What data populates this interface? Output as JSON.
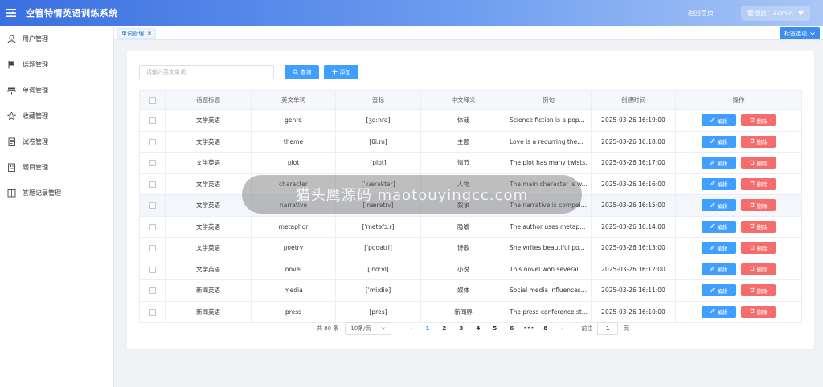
{
  "header": {
    "app_title": "空管特情英语训练系统",
    "back_home": "返回首页",
    "admin_label": "管理员：admin"
  },
  "sidebar": {
    "items": [
      {
        "label": "用户管理",
        "icon": "user-icon"
      },
      {
        "label": "话题管理",
        "icon": "flag-icon"
      },
      {
        "label": "单词管理",
        "icon": "sign-icon"
      },
      {
        "label": "收藏管理",
        "icon": "star-icon"
      },
      {
        "label": "试卷管理",
        "icon": "document-icon"
      },
      {
        "label": "题目管理",
        "icon": "form-icon"
      },
      {
        "label": "答题记录管理",
        "icon": "notebook-icon"
      }
    ]
  },
  "tags": {
    "active_tag": "单词管理",
    "options_label": "标签选项"
  },
  "toolbar": {
    "search_placeholder": "请输入英文单词",
    "query_label": "查询",
    "add_label": "添加"
  },
  "table": {
    "headers": [
      "话题标题",
      "英文单词",
      "音标",
      "中文释义",
      "例句",
      "创建时间",
      "操作"
    ],
    "edit_label": "编辑",
    "delete_label": "删除",
    "rows": [
      {
        "topic": "文学英语",
        "word": "genre",
        "phonetic": "[ʒɑːnrə]",
        "meaning": "体裁",
        "example": "Science fiction is a pop...",
        "time": "2025-03-26 16:19:00"
      },
      {
        "topic": "文学英语",
        "word": "theme",
        "phonetic": "[θiːm]",
        "meaning": "主题",
        "example": "Love is a recurring theme.",
        "time": "2025-03-26 16:18:00"
      },
      {
        "topic": "文学英语",
        "word": "plot",
        "phonetic": "[plɒt]",
        "meaning": "情节",
        "example": "The plot has many twists.",
        "time": "2025-03-26 16:17:00"
      },
      {
        "topic": "文学英语",
        "word": "character",
        "phonetic": "[ˈkærəktər]",
        "meaning": "人物",
        "example": "The main character is w...",
        "time": "2025-03-26 16:16:00"
      },
      {
        "topic": "文学英语",
        "word": "narrative",
        "phonetic": "[ˈnærətɪv]",
        "meaning": "叙事",
        "example": "The narrative is compell...",
        "time": "2025-03-26 16:15:00"
      },
      {
        "topic": "文学英语",
        "word": "metaphor",
        "phonetic": "[ˈmetəfɔːr]",
        "meaning": "隐喻",
        "example": "The author uses metap...",
        "time": "2025-03-26 16:14:00"
      },
      {
        "topic": "文学英语",
        "word": "poetry",
        "phonetic": "[ˈpoʊətri]",
        "meaning": "诗歌",
        "example": "She writes beautiful po...",
        "time": "2025-03-26 16:13:00"
      },
      {
        "topic": "文学英语",
        "word": "novel",
        "phonetic": "[ˈnɑːvl]",
        "meaning": "小说",
        "example": "This novel won several ...",
        "time": "2025-03-26 16:12:00"
      },
      {
        "topic": "新闻英语",
        "word": "media",
        "phonetic": "[ˈmiːdiə]",
        "meaning": "媒体",
        "example": "Social media influences ...",
        "time": "2025-03-26 16:11:00"
      },
      {
        "topic": "新闻英语",
        "word": "press",
        "phonetic": "[pres]",
        "meaning": "新闻界",
        "example": "The press conference st...",
        "time": "2025-03-26 16:10:00"
      }
    ]
  },
  "pagination": {
    "total": "共 80 条",
    "page_size": "10条/页",
    "pages": [
      "1",
      "2",
      "3",
      "4",
      "5",
      "6",
      "•••",
      "8"
    ],
    "goto_label": "前往",
    "goto_value": "1",
    "page_suffix": "页"
  },
  "overlay": {
    "text": "猫头鹰源码 maotouyingcc.com"
  },
  "colors": {
    "primary": "#409eff",
    "danger": "#f56c6c",
    "header_start": "#3a6fe0",
    "header_end": "#a9c6f5"
  }
}
